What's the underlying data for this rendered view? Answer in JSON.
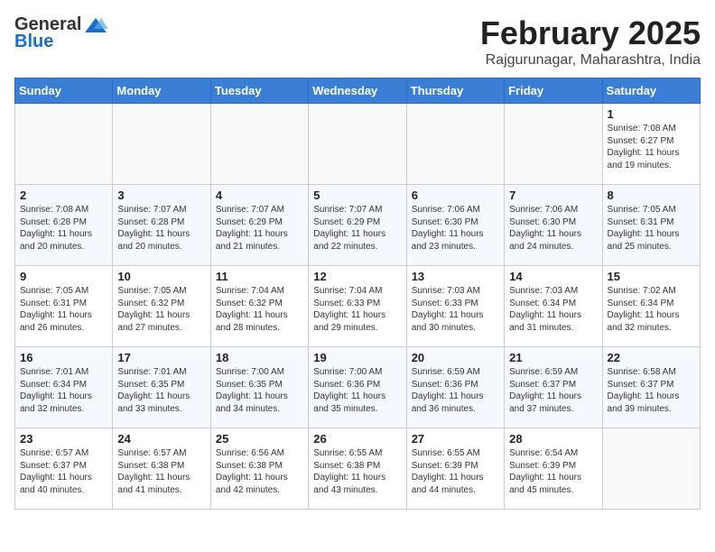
{
  "logo": {
    "general": "General",
    "blue": "Blue"
  },
  "header": {
    "month": "February 2025",
    "location": "Rajgurunagar, Maharashtra, India"
  },
  "weekdays": [
    "Sunday",
    "Monday",
    "Tuesday",
    "Wednesday",
    "Thursday",
    "Friday",
    "Saturday"
  ],
  "weeks": [
    [
      {
        "day": "",
        "info": ""
      },
      {
        "day": "",
        "info": ""
      },
      {
        "day": "",
        "info": ""
      },
      {
        "day": "",
        "info": ""
      },
      {
        "day": "",
        "info": ""
      },
      {
        "day": "",
        "info": ""
      },
      {
        "day": "1",
        "info": "Sunrise: 7:08 AM\nSunset: 6:27 PM\nDaylight: 11 hours\nand 19 minutes."
      }
    ],
    [
      {
        "day": "2",
        "info": "Sunrise: 7:08 AM\nSunset: 6:28 PM\nDaylight: 11 hours\nand 20 minutes."
      },
      {
        "day": "3",
        "info": "Sunrise: 7:07 AM\nSunset: 6:28 PM\nDaylight: 11 hours\nand 20 minutes."
      },
      {
        "day": "4",
        "info": "Sunrise: 7:07 AM\nSunset: 6:29 PM\nDaylight: 11 hours\nand 21 minutes."
      },
      {
        "day": "5",
        "info": "Sunrise: 7:07 AM\nSunset: 6:29 PM\nDaylight: 11 hours\nand 22 minutes."
      },
      {
        "day": "6",
        "info": "Sunrise: 7:06 AM\nSunset: 6:30 PM\nDaylight: 11 hours\nand 23 minutes."
      },
      {
        "day": "7",
        "info": "Sunrise: 7:06 AM\nSunset: 6:30 PM\nDaylight: 11 hours\nand 24 minutes."
      },
      {
        "day": "8",
        "info": "Sunrise: 7:05 AM\nSunset: 6:31 PM\nDaylight: 11 hours\nand 25 minutes."
      }
    ],
    [
      {
        "day": "9",
        "info": "Sunrise: 7:05 AM\nSunset: 6:31 PM\nDaylight: 11 hours\nand 26 minutes."
      },
      {
        "day": "10",
        "info": "Sunrise: 7:05 AM\nSunset: 6:32 PM\nDaylight: 11 hours\nand 27 minutes."
      },
      {
        "day": "11",
        "info": "Sunrise: 7:04 AM\nSunset: 6:32 PM\nDaylight: 11 hours\nand 28 minutes."
      },
      {
        "day": "12",
        "info": "Sunrise: 7:04 AM\nSunset: 6:33 PM\nDaylight: 11 hours\nand 29 minutes."
      },
      {
        "day": "13",
        "info": "Sunrise: 7:03 AM\nSunset: 6:33 PM\nDaylight: 11 hours\nand 30 minutes."
      },
      {
        "day": "14",
        "info": "Sunrise: 7:03 AM\nSunset: 6:34 PM\nDaylight: 11 hours\nand 31 minutes."
      },
      {
        "day": "15",
        "info": "Sunrise: 7:02 AM\nSunset: 6:34 PM\nDaylight: 11 hours\nand 32 minutes."
      }
    ],
    [
      {
        "day": "16",
        "info": "Sunrise: 7:01 AM\nSunset: 6:34 PM\nDaylight: 11 hours\nand 32 minutes."
      },
      {
        "day": "17",
        "info": "Sunrise: 7:01 AM\nSunset: 6:35 PM\nDaylight: 11 hours\nand 33 minutes."
      },
      {
        "day": "18",
        "info": "Sunrise: 7:00 AM\nSunset: 6:35 PM\nDaylight: 11 hours\nand 34 minutes."
      },
      {
        "day": "19",
        "info": "Sunrise: 7:00 AM\nSunset: 6:36 PM\nDaylight: 11 hours\nand 35 minutes."
      },
      {
        "day": "20",
        "info": "Sunrise: 6:59 AM\nSunset: 6:36 PM\nDaylight: 11 hours\nand 36 minutes."
      },
      {
        "day": "21",
        "info": "Sunrise: 6:59 AM\nSunset: 6:37 PM\nDaylight: 11 hours\nand 37 minutes."
      },
      {
        "day": "22",
        "info": "Sunrise: 6:58 AM\nSunset: 6:37 PM\nDaylight: 11 hours\nand 39 minutes."
      }
    ],
    [
      {
        "day": "23",
        "info": "Sunrise: 6:57 AM\nSunset: 6:37 PM\nDaylight: 11 hours\nand 40 minutes."
      },
      {
        "day": "24",
        "info": "Sunrise: 6:57 AM\nSunset: 6:38 PM\nDaylight: 11 hours\nand 41 minutes."
      },
      {
        "day": "25",
        "info": "Sunrise: 6:56 AM\nSunset: 6:38 PM\nDaylight: 11 hours\nand 42 minutes."
      },
      {
        "day": "26",
        "info": "Sunrise: 6:55 AM\nSunset: 6:38 PM\nDaylight: 11 hours\nand 43 minutes."
      },
      {
        "day": "27",
        "info": "Sunrise: 6:55 AM\nSunset: 6:39 PM\nDaylight: 11 hours\nand 44 minutes."
      },
      {
        "day": "28",
        "info": "Sunrise: 6:54 AM\nSunset: 6:39 PM\nDaylight: 11 hours\nand 45 minutes."
      },
      {
        "day": "",
        "info": ""
      }
    ]
  ]
}
